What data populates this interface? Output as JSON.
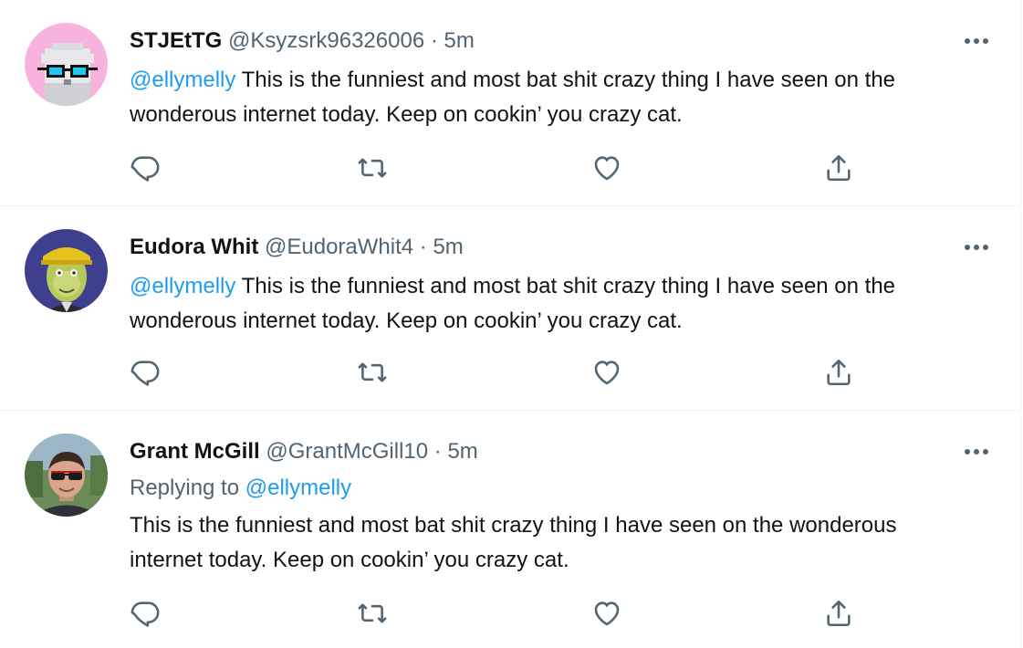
{
  "tweets": [
    {
      "display_name": "STJEtTG",
      "handle": "@Ksyzsrk96326006",
      "separator": "·",
      "time": "5m",
      "mention": "@ellymelly",
      "text": "This is the funniest and most bat shit crazy thing I have seen on the wonderous internet today. Keep on cookin’ you crazy cat.",
      "avatar_icon": "pixel-owl-avatar",
      "avatar_bg": "#f7b3dd"
    },
    {
      "display_name": "Eudora Whit",
      "handle": "@EudoraWhit4",
      "separator": "·",
      "time": "5m",
      "mention": "@ellymelly",
      "text": "This is the funniest and most bat shit crazy thing I have seen on the wonderous internet today. Keep on cookin’ you crazy cat.",
      "avatar_icon": "zombie-ape-avatar",
      "avatar_bg": "#3f3f8f"
    },
    {
      "display_name": "Grant McGill",
      "handle": "@GrantMcGill10",
      "separator": "·",
      "time": "5m",
      "replying_to_label": "Replying to",
      "mention": "@ellymelly",
      "text": "This is the funniest and most bat shit crazy thing I have seen on the wonderous internet today. Keep on cookin’ you crazy cat.",
      "avatar_icon": "photo-man-sunglasses-avatar",
      "avatar_bg": "#6a8a5a"
    }
  ],
  "icons": {
    "more": "more-horizontal-icon",
    "reply": "reply-icon",
    "retweet": "retweet-icon",
    "like": "heart-icon",
    "share": "share-icon"
  },
  "colors": {
    "mention": "#1d9bf0",
    "secondary_text": "#536471",
    "primary_text": "#0f1419",
    "divider": "#eff3f4"
  }
}
